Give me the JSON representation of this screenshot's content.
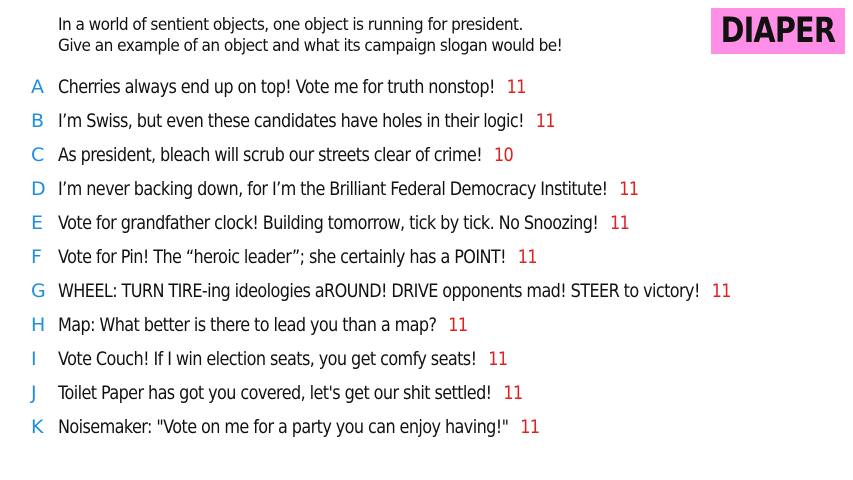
{
  "prompt": {
    "line1": "In a world of sentient objects, one object is running for president.",
    "line2": "Give an example of an object and what its campaign slogan would be!"
  },
  "badge": {
    "label": "DIAPER",
    "color": "#ff8fe6"
  },
  "colors": {
    "letter": "#1e8fe0",
    "score": "#e01f1f",
    "text": "#111111"
  },
  "answers": [
    {
      "letter": "A",
      "text": "Cherries always end up on top! Vote me for truth nonstop!",
      "score": "11"
    },
    {
      "letter": "B",
      "text": "I’m Swiss, but even these candidates have holes in their logic!",
      "score": "11"
    },
    {
      "letter": "C",
      "text": "As president, bleach will scrub our streets clear of crime!",
      "score": "10"
    },
    {
      "letter": "D",
      "text": "I’m never backing down, for I’m the Brilliant Federal Democracy Institute!",
      "score": "11"
    },
    {
      "letter": "E",
      "text": "Vote for grandfather clock! Building tomorrow, tick by tick. No Snoozing!",
      "score": "11"
    },
    {
      "letter": "F",
      "text": "Vote for Pin! The “heroic leader”; she certainly has a POINT!",
      "score": "11"
    },
    {
      "letter": "G",
      "text": "WHEEL: TURN TIRE-ing ideologies aROUND! DRIVE opponents mad! STEER to victory!",
      "score": "11"
    },
    {
      "letter": "H",
      "text": "Map: What better is there to lead you than a map?",
      "score": "11"
    },
    {
      "letter": "I",
      "text": "Vote Couch! If I win election seats, you get comfy seats!",
      "score": "11"
    },
    {
      "letter": "J",
      "text": "Toilet Paper has got you covered, let's get our shit settled!",
      "score": "11"
    },
    {
      "letter": "K",
      "text": "Noisemaker: \"Vote on me for a party you can enjoy having!\"",
      "score": "11"
    }
  ]
}
